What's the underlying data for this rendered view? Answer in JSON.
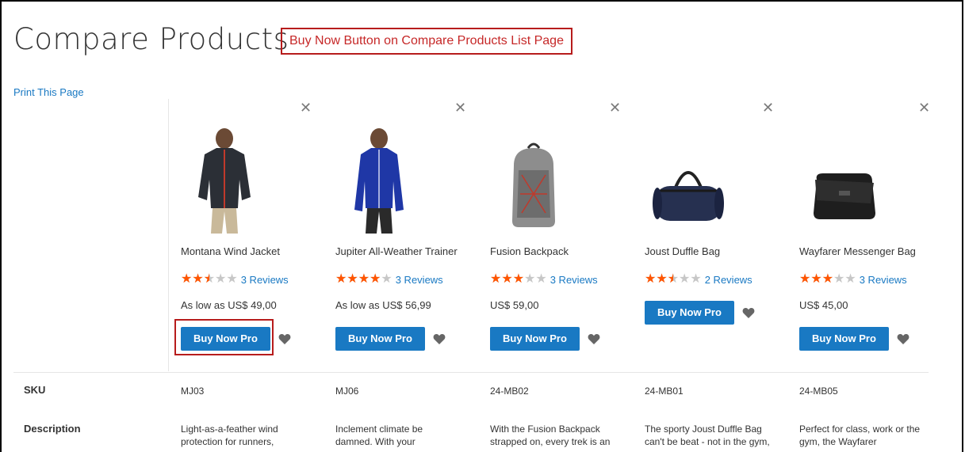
{
  "page": {
    "title": "Compare Products",
    "annotation": "Buy Now Button on Compare Products List Page",
    "print_link": "Print This Page"
  },
  "colors": {
    "accent": "#1979c3",
    "star": "#ff5501",
    "annotation": "#c62828"
  },
  "products": [
    {
      "name": "Montana Wind Jacket",
      "rating": 0.5,
      "reviews": "3  Reviews",
      "price": "As low as US$ 49,00",
      "buy": "Buy Now Pro",
      "sku": "MJ03",
      "description": [
        "Light-as-a-feather wind",
        "protection for runners,"
      ],
      "image": "jacket-icon"
    },
    {
      "name": "Jupiter All-Weather Trainer",
      "rating": 0.8,
      "reviews": "3  Reviews",
      "price": "As low as US$ 56,99",
      "buy": "Buy Now Pro",
      "sku": "MJ06",
      "description": [
        "Inclement climate be",
        "damned. With your"
      ],
      "image": "trainer-jacket-icon"
    },
    {
      "name": "Fusion Backpack",
      "rating": 0.6,
      "reviews": "3  Reviews",
      "price": "US$ 59,00",
      "buy": "Buy Now Pro",
      "sku": "24-MB02",
      "description": [
        "With the Fusion Backpack",
        "strapped on, every trek is an"
      ],
      "image": "backpack-icon"
    },
    {
      "name": "Joust Duffle Bag",
      "rating": 0.5,
      "reviews": "2  Reviews",
      "price": "",
      "buy": "Buy Now Pro",
      "sku": "24-MB01",
      "description": [
        "The sporty Joust Duffle Bag",
        "can't be beat - not in the gym,"
      ],
      "image": "duffle-bag-icon"
    },
    {
      "name": "Wayfarer Messenger Bag",
      "rating": 0.6,
      "reviews": "3  Reviews",
      "price": "US$ 45,00",
      "buy": "Buy Now Pro",
      "sku": "24-MB05",
      "description": [
        "Perfect for class, work or the",
        "gym, the Wayfarer"
      ],
      "image": "messenger-bag-icon"
    }
  ],
  "rows": {
    "sku_label": "SKU",
    "description_label": "Description"
  }
}
